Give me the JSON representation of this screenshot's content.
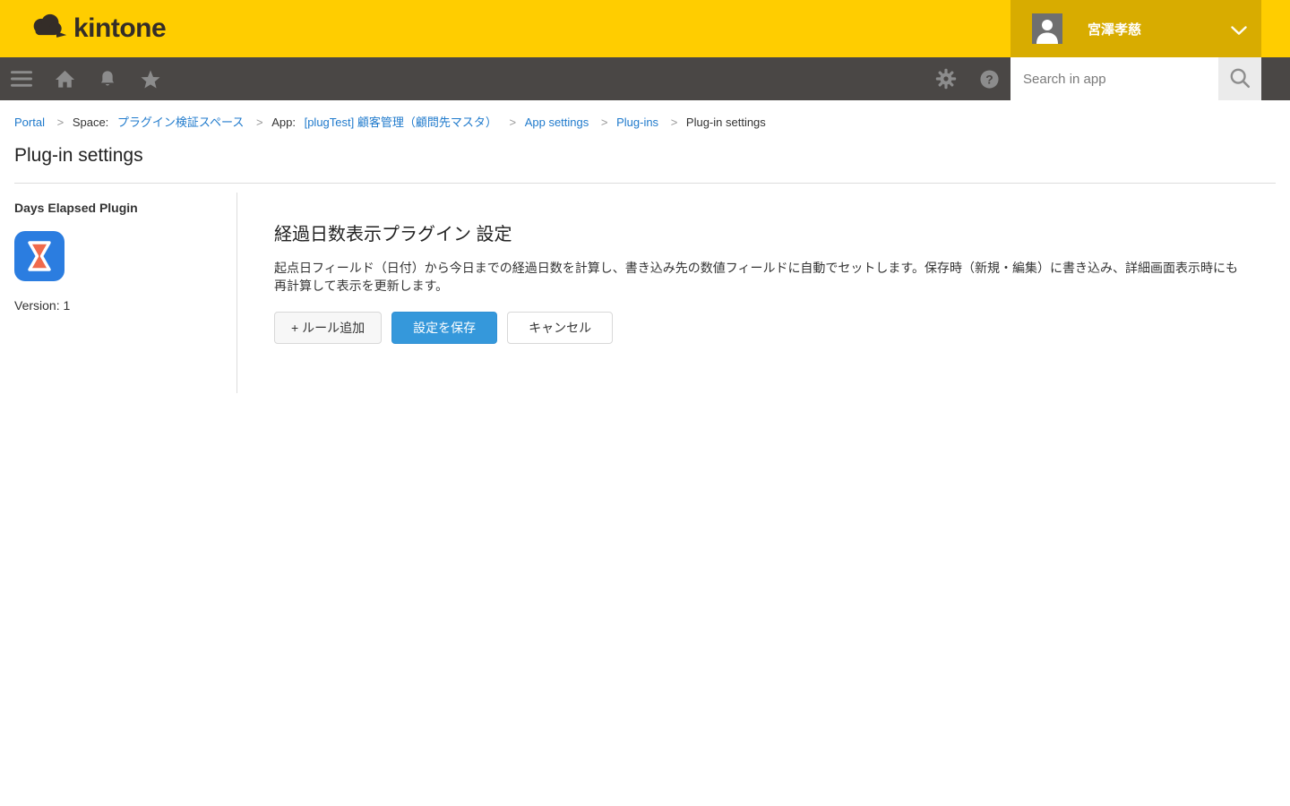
{
  "brand": {
    "logo_text": "kintone"
  },
  "header": {
    "user_name": "宮澤孝慈"
  },
  "nav": {
    "search_placeholder": "Search in app"
  },
  "breadcrumb": {
    "separator": ">",
    "portal": "Portal",
    "space_prefix": "Space:",
    "space_link": "プラグイン検証スペース",
    "app_prefix": "App:",
    "app_link": "[plugTest] 顧客管理（顧問先マスタ）",
    "app_settings": "App settings",
    "plugins": "Plug-ins",
    "current": "Plug-in settings"
  },
  "page": {
    "title": "Plug-in settings"
  },
  "sidebar": {
    "plugin_name": "Days Elapsed Plugin",
    "version": "Version: 1"
  },
  "main": {
    "heading": "経過日数表示プラグイン 設定",
    "description": "起点日フィールド（日付）から今日までの経過日数を計算し、書き込み先の数値フィールドに自動でセットします。保存時（新規・編集）に書き込み、詳細画面表示時にも再計算して表示を更新します。",
    "buttons": {
      "add_rule": "+ ルール追加",
      "save": "設定を保存",
      "cancel": "キャンセル"
    }
  },
  "icons": {
    "hamburger": "hamburger-menu-icon",
    "home": "home-icon",
    "bell": "notifications-bell-icon",
    "star": "favorites-star-icon",
    "gear": "gear-icon",
    "help": "help-icon",
    "search": "search-icon",
    "chevron": "chevron-down-icon",
    "avatar": "user-avatar-icon",
    "plugin": "hourglass-plugin-icon",
    "logo_cloud": "kintone-cloud-logo-icon"
  },
  "colors": {
    "header_yellow": "#ffcd00",
    "user_area_gold": "#d8ac00",
    "nav_dark": "#4a4745",
    "nav_icon_gray": "#8c8c8c",
    "link_blue": "#1f7acc",
    "save_button_blue": "#3598db",
    "plugin_icon_blue": "#2b7de0",
    "hourglass_orange": "#f06a4c",
    "logo_dark": "#342d28"
  }
}
